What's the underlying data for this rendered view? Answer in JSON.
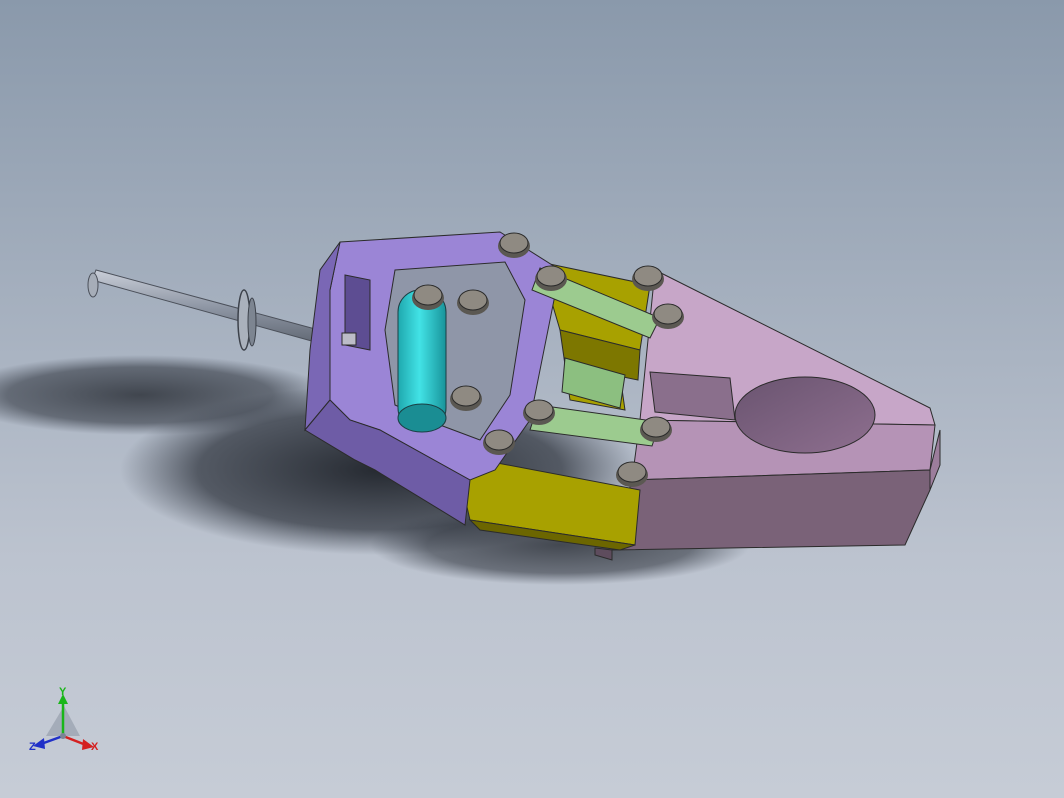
{
  "viewport": {
    "background_top": "#8a99ab",
    "background_bottom": "#c6ccd6"
  },
  "model": {
    "parts": [
      {
        "name": "drive-rod",
        "color": "#8e96a4"
      },
      {
        "name": "base-frame",
        "color": "#9b85d6"
      },
      {
        "name": "cylinder",
        "color": "#2fc7cc"
      },
      {
        "name": "drive-links",
        "color": "#a8a100"
      },
      {
        "name": "connecting-links",
        "color": "#9ccb8f"
      },
      {
        "name": "jaw-body",
        "color": "#c7a6c8"
      },
      {
        "name": "pins",
        "color": "#8f8a82"
      }
    ]
  },
  "triad": {
    "y_label": "Y",
    "x_label": "X",
    "z_label": "Z",
    "y_color": "#19b619",
    "x_color": "#d42020",
    "z_color": "#2030c8"
  }
}
